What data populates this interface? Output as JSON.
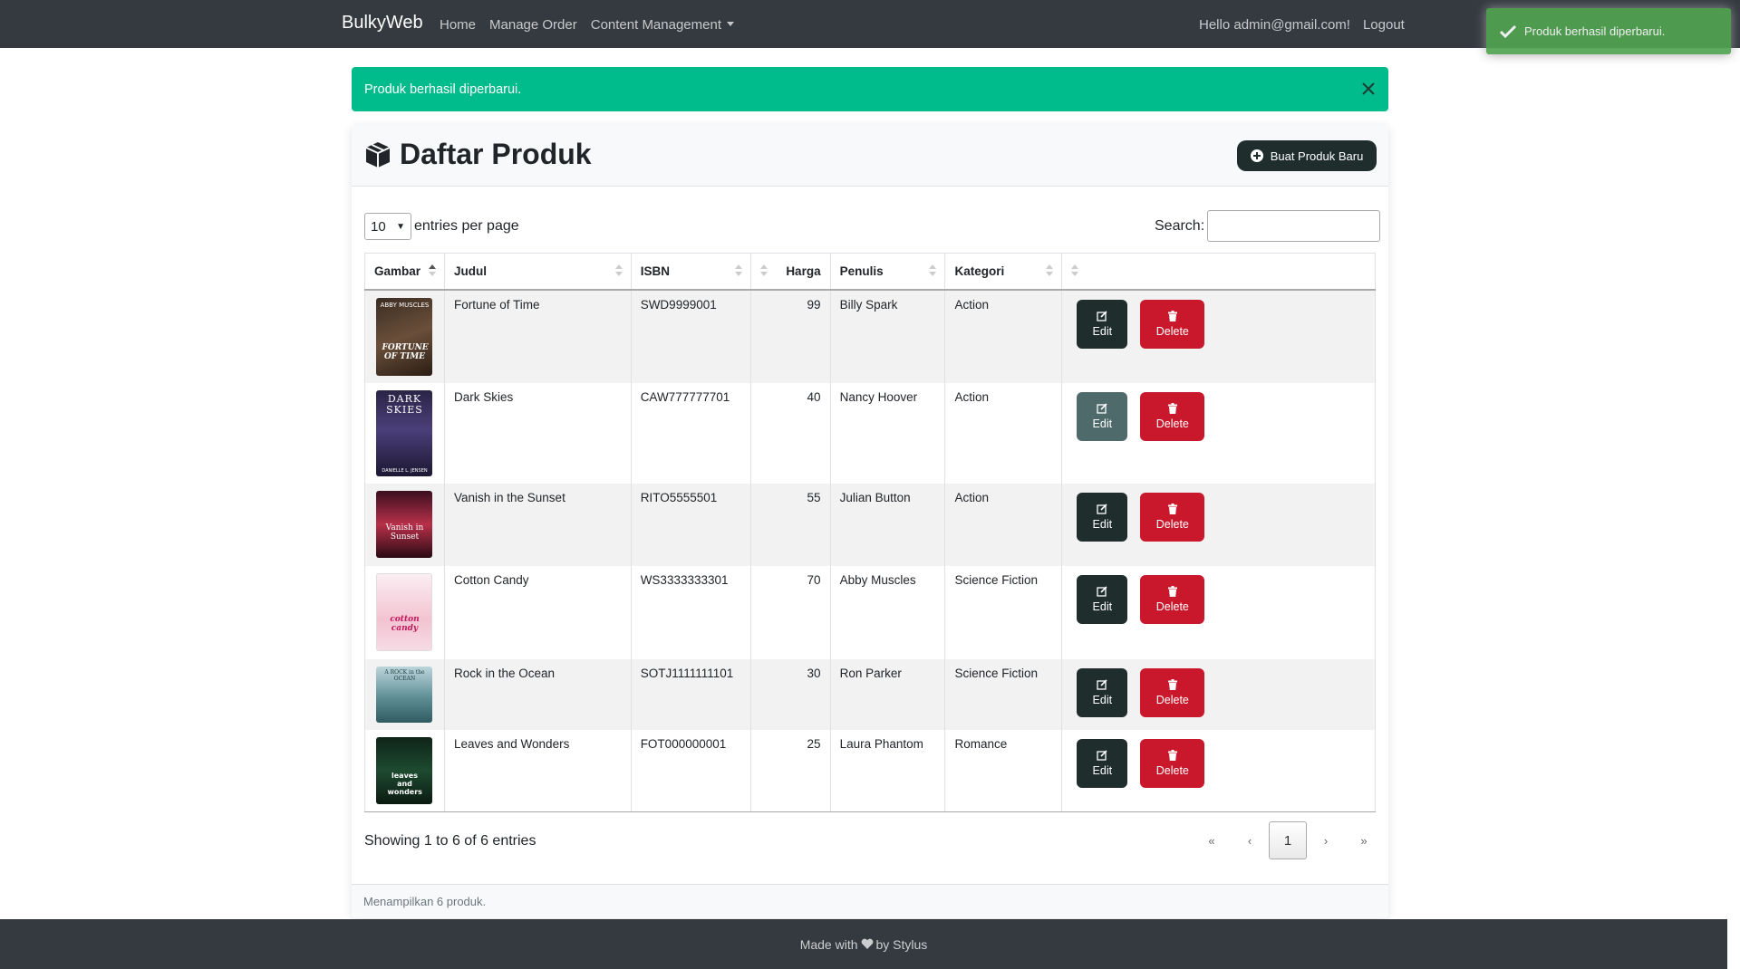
{
  "navbar": {
    "brand": "BulkyWeb",
    "links": [
      "Home",
      "Manage Order",
      "Content Management"
    ],
    "greeting": "Hello admin@gmail.com!",
    "logout": "Logout"
  },
  "toast": {
    "message": "Produk berhasil diperbarui.",
    "color": "#51a351"
  },
  "alert": {
    "message": "Produk berhasil diperbarui.",
    "color": "#00bc8c"
  },
  "card": {
    "title": "Daftar Produk",
    "new_button": "Buat Produk Baru",
    "footer_text": "Menampilkan 6 produk."
  },
  "controls": {
    "entries_value": "10",
    "entries_label": "entries per page",
    "search_label": "Search:",
    "search_value": ""
  },
  "table": {
    "columns": [
      "Gambar",
      "Judul",
      "ISBN",
      "Harga",
      "Penulis",
      "Kategori",
      ""
    ],
    "rows": [
      {
        "title": "Fortune of Time",
        "isbn": "SWD9999001",
        "price": "99",
        "author": "Billy Spark",
        "category": "Action",
        "cover_text": "FORTUNE OF TIME",
        "cover_top": "ABBY MUSCLES"
      },
      {
        "title": "Dark Skies",
        "isbn": "CAW777777701",
        "price": "40",
        "author": "Nancy Hoover",
        "category": "Action",
        "cover_text": "DARK SKIES",
        "cover_top": "DANIELLE L. JENSEN"
      },
      {
        "title": "Vanish in the Sunset",
        "isbn": "RITO5555501",
        "price": "55",
        "author": "Julian Button",
        "category": "Action",
        "cover_text": "Vanish in Sunset",
        "cover_top": ""
      },
      {
        "title": "Cotton Candy",
        "isbn": "WS3333333301",
        "price": "70",
        "author": "Abby Muscles",
        "category": "Science Fiction",
        "cover_text": "cotton candy",
        "cover_top": ""
      },
      {
        "title": "Rock in the Ocean",
        "isbn": "SOTJ1111111101",
        "price": "30",
        "author": "Ron Parker",
        "category": "Science Fiction",
        "cover_text": "A ROCK in the OCEAN",
        "cover_top": ""
      },
      {
        "title": "Leaves and Wonders",
        "isbn": "FOT000000001",
        "price": "25",
        "author": "Laura Phantom",
        "category": "Romance",
        "cover_text": "leaves and wonders",
        "cover_top": ""
      }
    ],
    "edit_label": "Edit",
    "delete_label": "Delete"
  },
  "pagination": {
    "info": "Showing 1 to 6 of 6 entries",
    "first": "«",
    "prev": "‹",
    "current": "1",
    "next": "›",
    "last": "»"
  },
  "footer": {
    "before": "Made with",
    "after": "by Stylus"
  },
  "colors": {
    "navbar": "#343a40",
    "primary_dark": "#1f2d2d",
    "danger": "#c9182b",
    "success": "#00bc8c"
  }
}
